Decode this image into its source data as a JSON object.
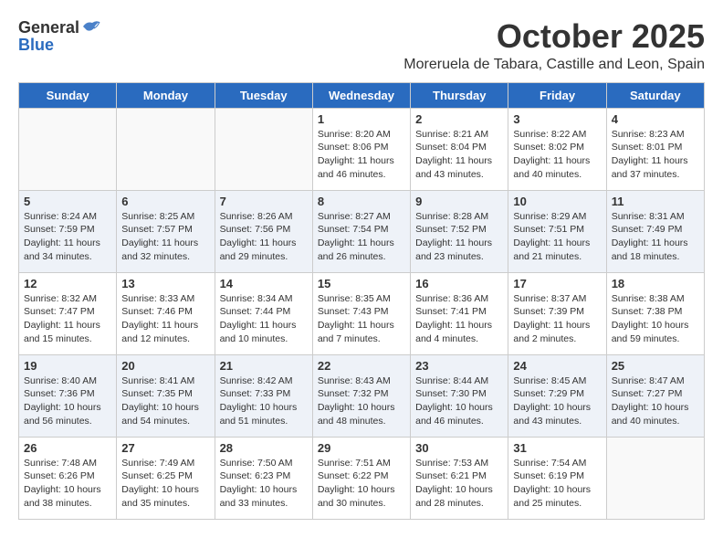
{
  "header": {
    "logo_general": "General",
    "logo_blue": "Blue",
    "title": "October 2025",
    "subtitle": "Moreruela de Tabara, Castille and Leon, Spain"
  },
  "days_of_week": [
    "Sunday",
    "Monday",
    "Tuesday",
    "Wednesday",
    "Thursday",
    "Friday",
    "Saturday"
  ],
  "weeks": [
    [
      {
        "day": "",
        "info": ""
      },
      {
        "day": "",
        "info": ""
      },
      {
        "day": "",
        "info": ""
      },
      {
        "day": "1",
        "info": "Sunrise: 8:20 AM\nSunset: 8:06 PM\nDaylight: 11 hours and 46 minutes."
      },
      {
        "day": "2",
        "info": "Sunrise: 8:21 AM\nSunset: 8:04 PM\nDaylight: 11 hours and 43 minutes."
      },
      {
        "day": "3",
        "info": "Sunrise: 8:22 AM\nSunset: 8:02 PM\nDaylight: 11 hours and 40 minutes."
      },
      {
        "day": "4",
        "info": "Sunrise: 8:23 AM\nSunset: 8:01 PM\nDaylight: 11 hours and 37 minutes."
      }
    ],
    [
      {
        "day": "5",
        "info": "Sunrise: 8:24 AM\nSunset: 7:59 PM\nDaylight: 11 hours and 34 minutes."
      },
      {
        "day": "6",
        "info": "Sunrise: 8:25 AM\nSunset: 7:57 PM\nDaylight: 11 hours and 32 minutes."
      },
      {
        "day": "7",
        "info": "Sunrise: 8:26 AM\nSunset: 7:56 PM\nDaylight: 11 hours and 29 minutes."
      },
      {
        "day": "8",
        "info": "Sunrise: 8:27 AM\nSunset: 7:54 PM\nDaylight: 11 hours and 26 minutes."
      },
      {
        "day": "9",
        "info": "Sunrise: 8:28 AM\nSunset: 7:52 PM\nDaylight: 11 hours and 23 minutes."
      },
      {
        "day": "10",
        "info": "Sunrise: 8:29 AM\nSunset: 7:51 PM\nDaylight: 11 hours and 21 minutes."
      },
      {
        "day": "11",
        "info": "Sunrise: 8:31 AM\nSunset: 7:49 PM\nDaylight: 11 hours and 18 minutes."
      }
    ],
    [
      {
        "day": "12",
        "info": "Sunrise: 8:32 AM\nSunset: 7:47 PM\nDaylight: 11 hours and 15 minutes."
      },
      {
        "day": "13",
        "info": "Sunrise: 8:33 AM\nSunset: 7:46 PM\nDaylight: 11 hours and 12 minutes."
      },
      {
        "day": "14",
        "info": "Sunrise: 8:34 AM\nSunset: 7:44 PM\nDaylight: 11 hours and 10 minutes."
      },
      {
        "day": "15",
        "info": "Sunrise: 8:35 AM\nSunset: 7:43 PM\nDaylight: 11 hours and 7 minutes."
      },
      {
        "day": "16",
        "info": "Sunrise: 8:36 AM\nSunset: 7:41 PM\nDaylight: 11 hours and 4 minutes."
      },
      {
        "day": "17",
        "info": "Sunrise: 8:37 AM\nSunset: 7:39 PM\nDaylight: 11 hours and 2 minutes."
      },
      {
        "day": "18",
        "info": "Sunrise: 8:38 AM\nSunset: 7:38 PM\nDaylight: 10 hours and 59 minutes."
      }
    ],
    [
      {
        "day": "19",
        "info": "Sunrise: 8:40 AM\nSunset: 7:36 PM\nDaylight: 10 hours and 56 minutes."
      },
      {
        "day": "20",
        "info": "Sunrise: 8:41 AM\nSunset: 7:35 PM\nDaylight: 10 hours and 54 minutes."
      },
      {
        "day": "21",
        "info": "Sunrise: 8:42 AM\nSunset: 7:33 PM\nDaylight: 10 hours and 51 minutes."
      },
      {
        "day": "22",
        "info": "Sunrise: 8:43 AM\nSunset: 7:32 PM\nDaylight: 10 hours and 48 minutes."
      },
      {
        "day": "23",
        "info": "Sunrise: 8:44 AM\nSunset: 7:30 PM\nDaylight: 10 hours and 46 minutes."
      },
      {
        "day": "24",
        "info": "Sunrise: 8:45 AM\nSunset: 7:29 PM\nDaylight: 10 hours and 43 minutes."
      },
      {
        "day": "25",
        "info": "Sunrise: 8:47 AM\nSunset: 7:27 PM\nDaylight: 10 hours and 40 minutes."
      }
    ],
    [
      {
        "day": "26",
        "info": "Sunrise: 7:48 AM\nSunset: 6:26 PM\nDaylight: 10 hours and 38 minutes."
      },
      {
        "day": "27",
        "info": "Sunrise: 7:49 AM\nSunset: 6:25 PM\nDaylight: 10 hours and 35 minutes."
      },
      {
        "day": "28",
        "info": "Sunrise: 7:50 AM\nSunset: 6:23 PM\nDaylight: 10 hours and 33 minutes."
      },
      {
        "day": "29",
        "info": "Sunrise: 7:51 AM\nSunset: 6:22 PM\nDaylight: 10 hours and 30 minutes."
      },
      {
        "day": "30",
        "info": "Sunrise: 7:53 AM\nSunset: 6:21 PM\nDaylight: 10 hours and 28 minutes."
      },
      {
        "day": "31",
        "info": "Sunrise: 7:54 AM\nSunset: 6:19 PM\nDaylight: 10 hours and 25 minutes."
      },
      {
        "day": "",
        "info": ""
      }
    ]
  ]
}
